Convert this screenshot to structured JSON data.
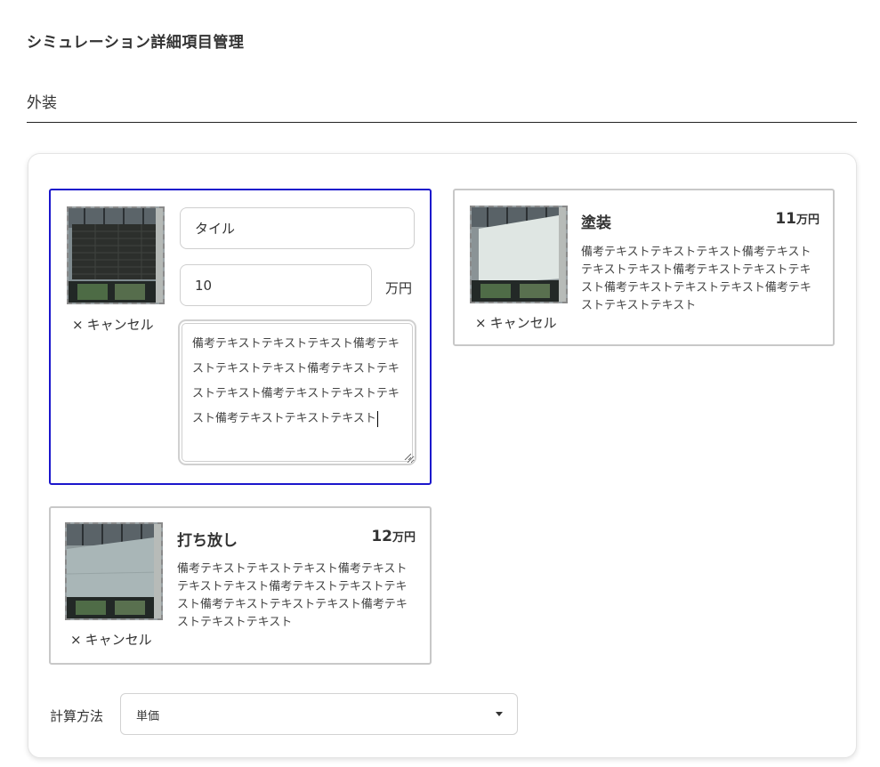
{
  "page": {
    "title": "シミュレーション詳細項目管理"
  },
  "section": {
    "title": "外装"
  },
  "colors": {
    "active_border": "#1b16cc",
    "card_border": "#c8c8c8"
  },
  "cards": [
    {
      "state": "editing",
      "thumbnail": "tile-facade-image",
      "cancel_label": "キャンセル",
      "name_value": "タイル",
      "price_value": "10",
      "unit": "万円",
      "note": "備考テキストテキストテキスト備考テキストテキストテキスト備考テキストテキストテキスト備考テキストテキストテキスト備考テキストテキストテキスト"
    },
    {
      "state": "view",
      "thumbnail": "painted-facade-image",
      "cancel_label": "キャンセル",
      "name": "塗装",
      "price_number": "11",
      "unit": "万円",
      "note": "備考テキストテキストテキスト備考テキストテキストテキスト備考テキストテキストテキスト備考テキストテキストテキスト備考テキストテキストテキスト"
    },
    {
      "state": "view",
      "thumbnail": "exposed-concrete-facade-image",
      "cancel_label": "キャンセル",
      "name": "打ち放し",
      "price_number": "12",
      "unit": "万円",
      "note": "備考テキストテキストテキスト備考テキストテキストテキスト備考テキストテキストテキスト備考テキストテキストテキスト備考テキストテキストテキスト"
    }
  ],
  "calc": {
    "label": "計算方法",
    "selected": "単価"
  },
  "icons": {
    "cancel": "close-x-icon",
    "dropdown": "caret-down-icon"
  }
}
